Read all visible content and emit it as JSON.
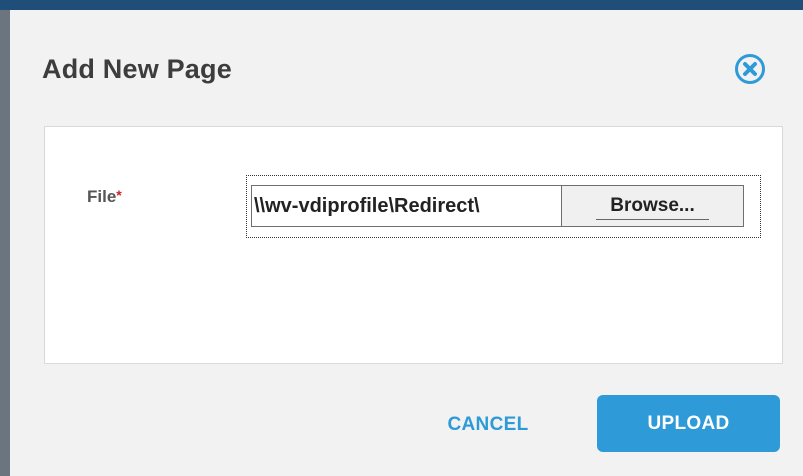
{
  "dialog": {
    "title": "Add New Page",
    "close_icon": "circle-x-icon"
  },
  "form": {
    "file_label": "File",
    "required_mark": "*",
    "file_path_value": "\\\\wv-vdiprofile\\Redirect\\",
    "browse_label": "Browse..."
  },
  "actions": {
    "cancel_label": "CANCEL",
    "upload_label": "UPLOAD"
  },
  "colors": {
    "accent": "#2e9ad8",
    "required": "#cc2222",
    "title_text": "#3d3d3d"
  }
}
